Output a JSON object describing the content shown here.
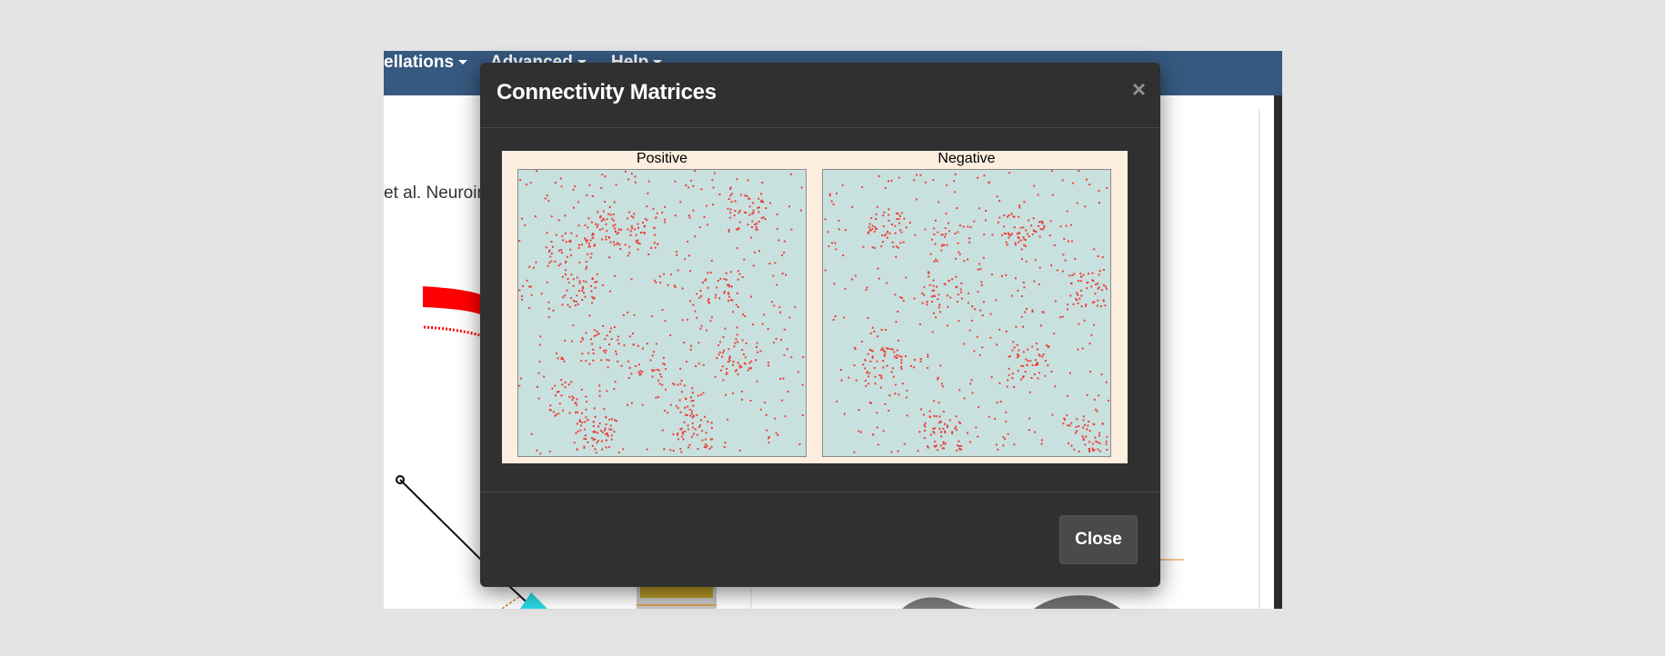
{
  "navbar": {
    "items": [
      {
        "label": "ellations"
      },
      {
        "label": "Advanced"
      },
      {
        "label": "Help"
      }
    ]
  },
  "background": {
    "citation": "et al. Neuroim"
  },
  "modal": {
    "title": "Connectivity Matrices",
    "close_symbol": "×",
    "close_button": "Close",
    "panels": [
      {
        "title": "Positive"
      },
      {
        "title": "Negative"
      }
    ]
  },
  "colors": {
    "navbar": "#36597f",
    "modal_bg": "#303030",
    "figure_bg": "#fdeee0",
    "matrix_bg": "#c9e1de",
    "edge_color": "#e8413c"
  }
}
